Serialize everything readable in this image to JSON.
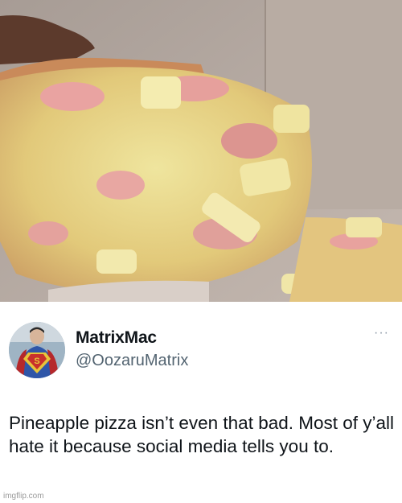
{
  "tweet": {
    "display_name": "MatrixMac",
    "handle": "@OozaruMatrix",
    "text": "Pineapple pizza isn’t even that bad. Most of y’all hate it because social media tells you to.",
    "more_label": "···"
  },
  "watermark": "imgflip.com",
  "icons": {
    "more": "more-options-icon",
    "avatar": "superman-avatar"
  },
  "colors": {
    "name": "#0f1419",
    "handle": "#536471",
    "text": "#0f1419"
  }
}
